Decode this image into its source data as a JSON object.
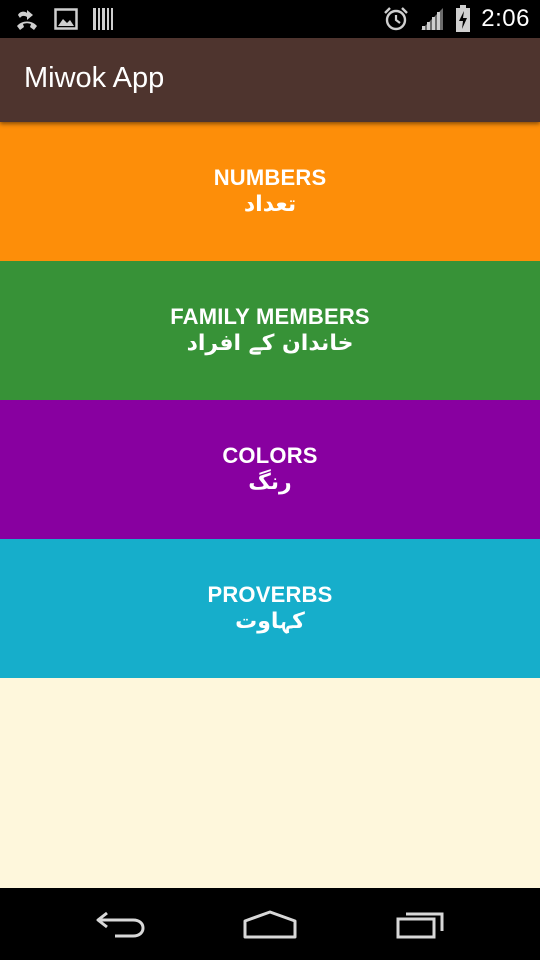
{
  "status_bar": {
    "time": "2:06",
    "left_icons": [
      "call-forward-icon",
      "image-icon",
      "barcode-icon"
    ],
    "right_icons": [
      "alarm-icon",
      "signal-icon",
      "battery-charging-icon"
    ]
  },
  "app_bar": {
    "title": "Miwok App",
    "color": "#4e342e"
  },
  "categories": [
    {
      "label": "NUMBERS",
      "sublabel": "تعداد",
      "color": "#fd8e09"
    },
    {
      "label": "FAMILY MEMBERS",
      "sublabel": "خاندان کے افراد",
      "color": "#379237"
    },
    {
      "label": "COLORS",
      "sublabel": "رنگ",
      "color": "#8800a0"
    },
    {
      "label": "PROVERBS",
      "sublabel": "کہاوت",
      "color": "#16aecb"
    }
  ],
  "background_color": "#fef7dc",
  "nav_bar": {
    "icons": [
      "back-icon",
      "home-icon",
      "recents-icon"
    ]
  }
}
